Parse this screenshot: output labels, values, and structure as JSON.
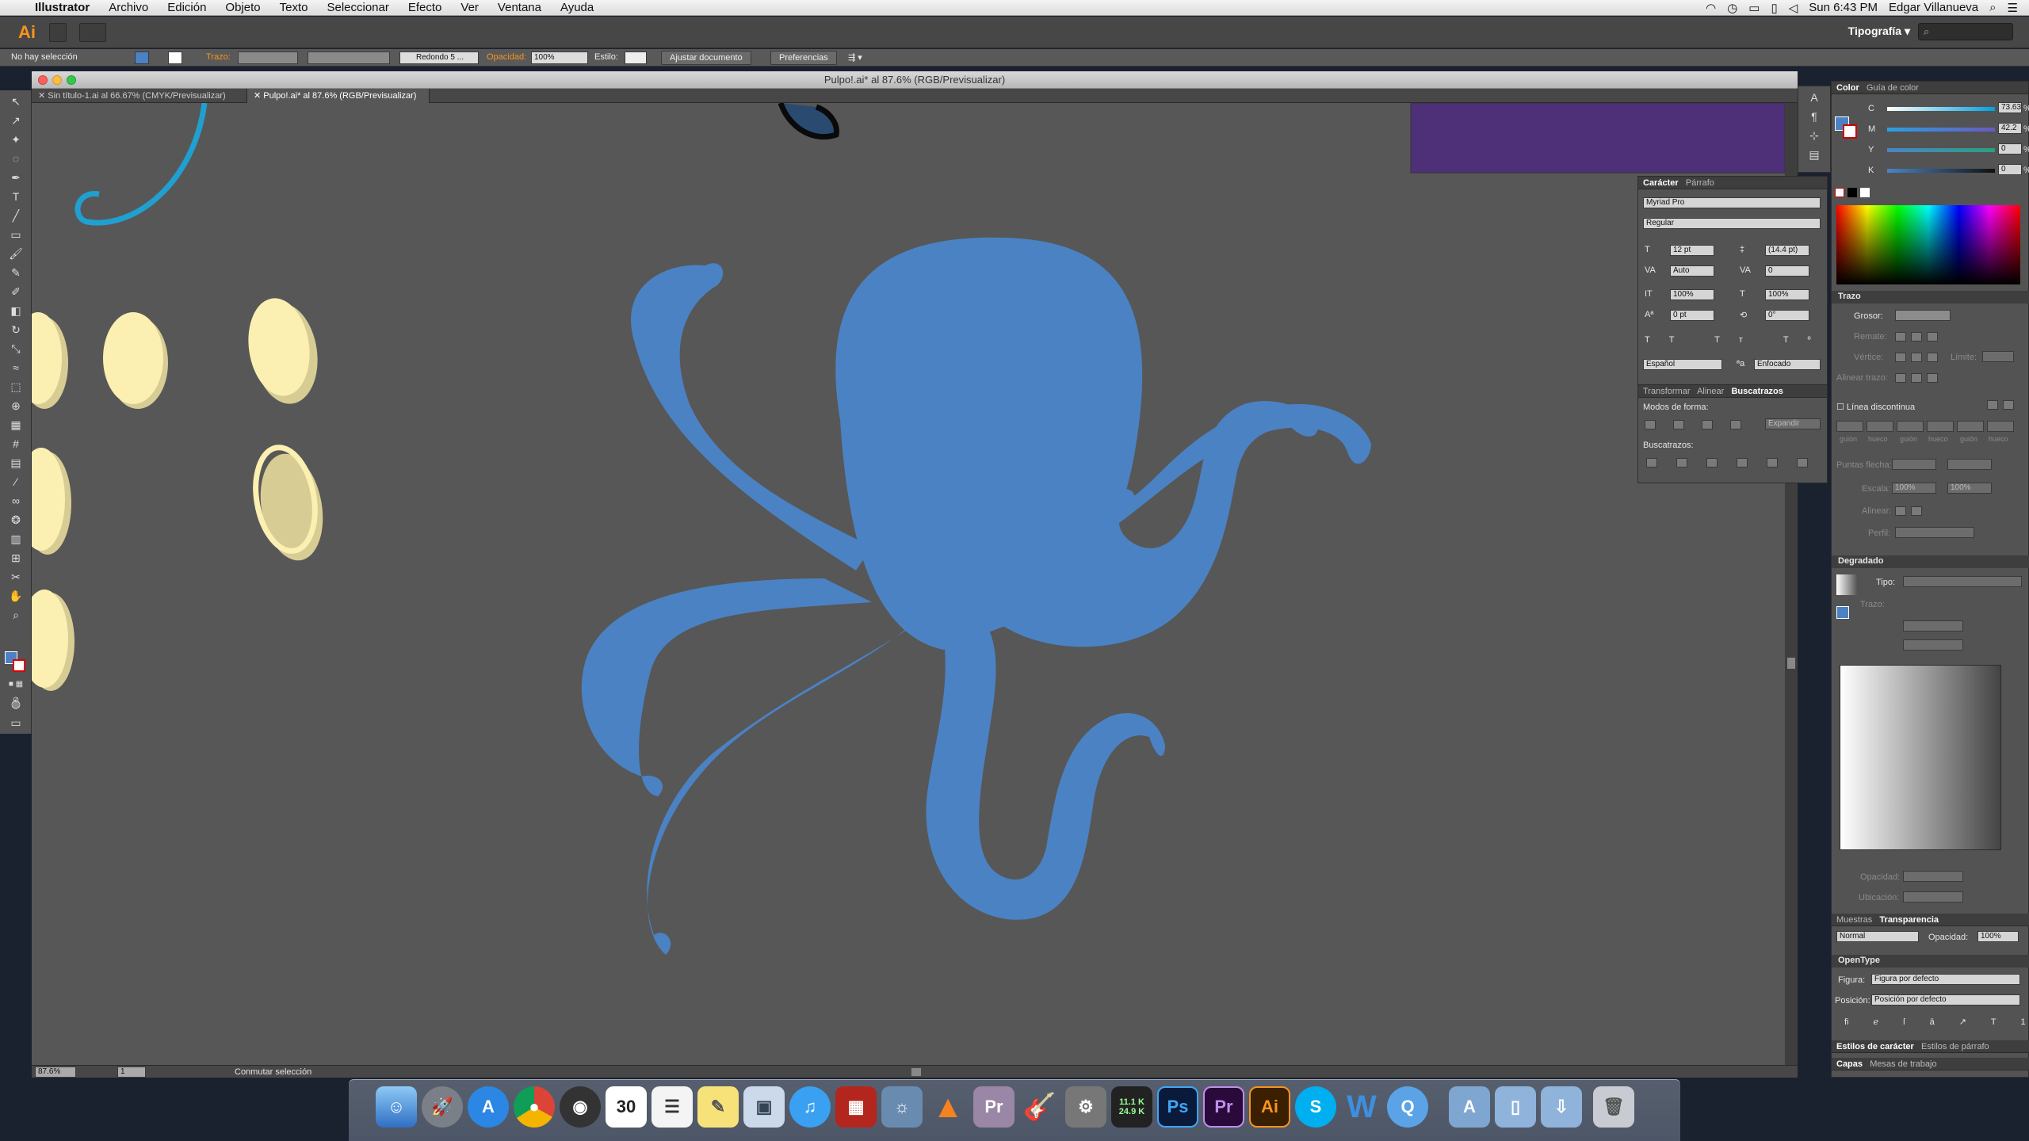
{
  "menubar": {
    "apple": "",
    "app": "Illustrator",
    "items": [
      "Archivo",
      "Edición",
      "Objeto",
      "Texto",
      "Seleccionar",
      "Efecto",
      "Ver",
      "Ventana",
      "Ayuda"
    ],
    "clock": "Sun 6:43 PM",
    "user": "Edgar Villanueva"
  },
  "appbar": {
    "logo": "Ai",
    "workspace": "Tipografía",
    "workspace_arrow": "▾",
    "search_placeholder": "⌕"
  },
  "control": {
    "selection": "No hay selección",
    "stroke_label": "Trazo:",
    "brush": "Redondo 5 ...",
    "opacity_label": "Opacidad:",
    "opacity_value": "100%",
    "style_label": "Estilo:",
    "fit_button": "Ajustar documento",
    "prefs_button": "Preferencias"
  },
  "document": {
    "title": "Pulpo!.ai* al 87.6% (RGB/Previsualizar)",
    "tabs": [
      "Sin título-1.ai al 66.67% (CMYK/Previsualizar)",
      "Pulpo!.ai* al 87.6% (RGB/Previsualizar)"
    ],
    "zoom": "87.6%",
    "page": "1",
    "status": "Conmutar selección"
  },
  "colors": {
    "octopus": "#4b82c3",
    "canvas": "#575757",
    "purple": "#4e3078",
    "egg": "#fbefb1",
    "eggShadow": "#d8cc95",
    "swirl": "#1fa0d0"
  },
  "character_panel": {
    "tabs": [
      "Carácter",
      "Párrafo"
    ],
    "font": "Myriad Pro",
    "style": "Regular",
    "size": "12 pt",
    "leading": "(14.4 pt)",
    "kerning": "Auto",
    "tracking": "0",
    "vscale": "100%",
    "hscale": "100%",
    "baseline": "0 pt",
    "rotation": "0°",
    "language": "Español",
    "aa_label": "ªa",
    "antialias": "Enfocado"
  },
  "pathfinder_panel": {
    "tabs": [
      "Transformar",
      "Alinear",
      "Buscatrazos"
    ],
    "shape_modes": "Modos de forma:",
    "expand": "Expandir",
    "pathfinders": "Buscatrazos:"
  },
  "color_panel": {
    "tabs": [
      "Color",
      "Guía de color"
    ],
    "c_label": "C",
    "c": "73.63",
    "m_label": "M",
    "m": "42.2",
    "y_label": "Y",
    "y": "0",
    "k_label": "K",
    "k": "0",
    "pct": "%"
  },
  "stroke_panel": {
    "title": "Trazo",
    "weight": "Grosor:",
    "cap": "Remate:",
    "corner": "Vértice:",
    "limit": "Límite:",
    "align": "Alinear trazo:",
    "dashed": "Línea discontinua",
    "dash_labels": [
      "guión",
      "hueco",
      "guión",
      "hueco",
      "guión",
      "hueco"
    ],
    "arrows": "Puntas flecha:",
    "scale": "Escala:",
    "scale_a": "100%",
    "scale_b": "100%",
    "align2": "Alinear:",
    "profile": "Perfil:"
  },
  "gradient_panel": {
    "title": "Degradado",
    "type": "Tipo:",
    "stroke": "Trazo:",
    "opacity": "Opacidad:",
    "location": "Ubicación:"
  },
  "transparency_panel": {
    "tabs": [
      "Muestras",
      "Transparencia"
    ],
    "mode": "Normal",
    "opacity_label": "Opacidad:",
    "opacity": "100%"
  },
  "opentype_panel": {
    "title": "OpenType",
    "figure_label": "Figura:",
    "figure": "Figura por defecto",
    "position_label": "Posición:",
    "position": "Posición por defecto"
  },
  "bottom_tabs": {
    "a": [
      "Estilos de carácter",
      "Estilos de párrafo"
    ],
    "b": [
      "Capas",
      "Mesas de trabajo"
    ]
  },
  "dock": {
    "items": [
      "Finder",
      "Launchpad",
      "App Store",
      "Chrome",
      "Dashboard",
      "Calendar",
      "Reminders",
      "Notes",
      "Preview",
      "iTunes",
      "Photo Booth",
      "iPhoto",
      "VLC",
      "Premiere",
      "GarageBand",
      "System Preferences",
      "Activity",
      "Photoshop",
      "Premiere Pro",
      "Illustrator",
      "Skype",
      "Word",
      "QuickTime",
      "Applications",
      "Documents",
      "Downloads",
      "Trash"
    ],
    "calendar_day": "30",
    "activity_up": "11.1 K",
    "activity_down": "24.9 K",
    "ps": "Ps",
    "pr": "Pr",
    "ai": "Ai"
  }
}
